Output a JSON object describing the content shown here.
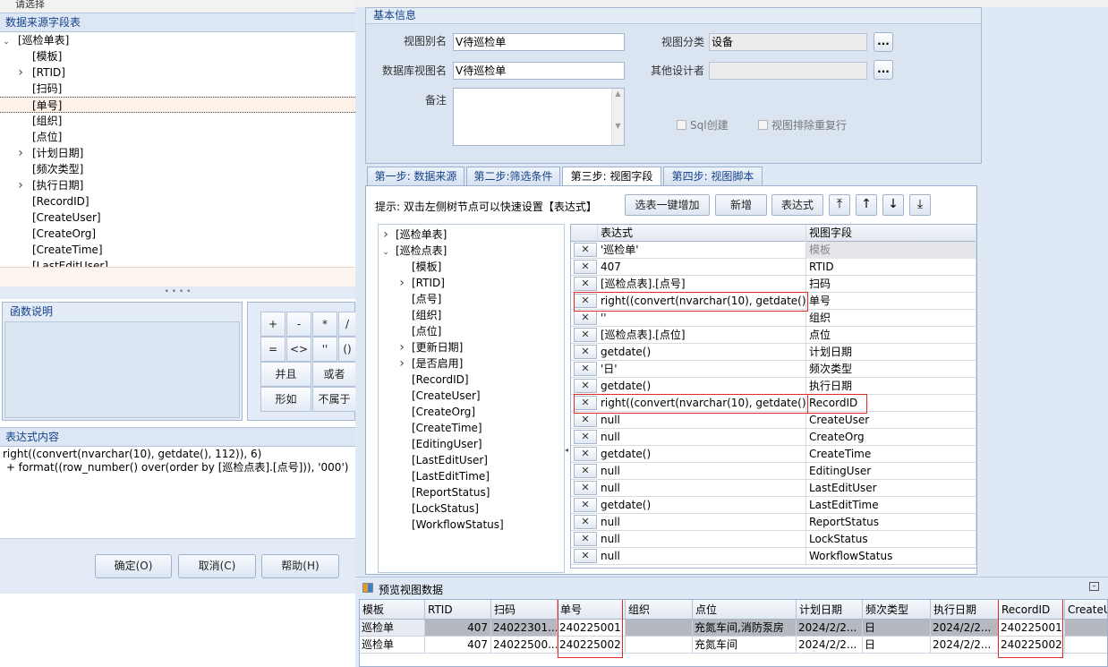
{
  "left_dialog": {
    "title": "请选择",
    "source_header": "数据来源字段表",
    "source_tree": [
      {
        "label": "[巡检单表]",
        "arrow": "open",
        "level": 0
      },
      {
        "label": "[模板]",
        "arrow": "",
        "level": 1
      },
      {
        "label": "[RTID]",
        "arrow": "closed",
        "level": 1
      },
      {
        "label": "[扫码]",
        "arrow": "",
        "level": 1
      },
      {
        "label": "[单号]",
        "arrow": "",
        "level": 1,
        "selected": true
      },
      {
        "label": "[组织]",
        "arrow": "",
        "level": 1
      },
      {
        "label": "[点位]",
        "arrow": "",
        "level": 1
      },
      {
        "label": "[计划日期]",
        "arrow": "closed",
        "level": 1
      },
      {
        "label": "[频次类型]",
        "arrow": "",
        "level": 1
      },
      {
        "label": "[执行日期]",
        "arrow": "closed",
        "level": 1
      },
      {
        "label": "[RecordID]",
        "arrow": "",
        "level": 1
      },
      {
        "label": "[CreateUser]",
        "arrow": "",
        "level": 1
      },
      {
        "label": "[CreateOrg]",
        "arrow": "",
        "level": 1
      },
      {
        "label": "[CreateTime]",
        "arrow": "",
        "level": 1
      },
      {
        "label": "[LastEditUser]",
        "arrow": "",
        "level": 1
      }
    ],
    "func_desc_title": "函数说明",
    "operators": [
      "+",
      "-",
      "*",
      "/",
      "=",
      "<>",
      "''",
      "()",
      "并且",
      "或者",
      "形如",
      "不属于"
    ],
    "expr_header": "表达式内容",
    "expr_text": "right((convert(nvarchar(10), getdate(), 112)), 6)\n + format((row_number() over(order by [巡检点表].[点号])), '000')",
    "buttons": {
      "ok": "确定(O)",
      "cancel": "取消(C)",
      "help": "帮助(H)"
    }
  },
  "basic_info": {
    "header": "基本信息",
    "view_alias_label": "视图别名",
    "view_alias_value": "V待巡检单",
    "db_view_label": "数据库视图名",
    "db_view_value": "V待巡检单",
    "remark_label": "备注",
    "category_label": "视图分类",
    "category_value": "设备",
    "other_designer_label": "其他设计者",
    "ellipsis": "...",
    "sql_create_label": "Sql创建",
    "dedupe_label": "视图排除重复行"
  },
  "tabs": [
    "第一步: 数据来源",
    "第二步:筛选条件",
    "第三步: 视图字段",
    "第四步: 视图脚本"
  ],
  "active_tab": 2,
  "hint": "提示: 双击左侧树节点可以快速设置【表达式】",
  "toolbar": {
    "select_add": "选表一键增加",
    "add_new": "新增",
    "expression": "表达式",
    "icons": [
      "move-top-icon",
      "move-up-icon",
      "move-down-icon",
      "move-bottom-icon"
    ],
    "glyphs": [
      "⤒",
      "↑",
      "↓",
      "⤓"
    ]
  },
  "field_tree": [
    {
      "label": "[巡检单表]",
      "arrow": "closed",
      "level": 0
    },
    {
      "label": "[巡检点表]",
      "arrow": "open",
      "level": 0
    },
    {
      "label": "[模板]",
      "arrow": "",
      "level": 1
    },
    {
      "label": "[RTID]",
      "arrow": "closed",
      "level": 1
    },
    {
      "label": "[点号]",
      "arrow": "",
      "level": 1
    },
    {
      "label": "[组织]",
      "arrow": "",
      "level": 1
    },
    {
      "label": "[点位]",
      "arrow": "",
      "level": 1
    },
    {
      "label": "[更新日期]",
      "arrow": "closed",
      "level": 1
    },
    {
      "label": "[是否启用]",
      "arrow": "closed",
      "level": 1
    },
    {
      "label": "[RecordID]",
      "arrow": "",
      "level": 1
    },
    {
      "label": "[CreateUser]",
      "arrow": "",
      "level": 1
    },
    {
      "label": "[CreateOrg]",
      "arrow": "",
      "level": 1
    },
    {
      "label": "[CreateTime]",
      "arrow": "",
      "level": 1
    },
    {
      "label": "[EditingUser]",
      "arrow": "",
      "level": 1
    },
    {
      "label": "[LastEditUser]",
      "arrow": "",
      "level": 1
    },
    {
      "label": "[LastEditTime]",
      "arrow": "",
      "level": 1
    },
    {
      "label": "[ReportStatus]",
      "arrow": "",
      "level": 1
    },
    {
      "label": "[LockStatus]",
      "arrow": "",
      "level": 1
    },
    {
      "label": "[WorkflowStatus]",
      "arrow": "",
      "level": 1
    }
  ],
  "field_grid": {
    "headers": [
      "表达式",
      "视图字段"
    ],
    "rows": [
      {
        "expr": "'巡检单'",
        "field": "模板",
        "grey": true
      },
      {
        "expr": "407",
        "field": "RTID"
      },
      {
        "expr": "[巡检点表].[点号]",
        "field": "扫码"
      },
      {
        "expr": "right((convert(nvarchar(10), getdate()...",
        "field": "单号",
        "boxed": true
      },
      {
        "expr": "''",
        "field": "组织"
      },
      {
        "expr": "[巡检点表].[点位]",
        "field": "点位"
      },
      {
        "expr": "getdate()",
        "field": "计划日期"
      },
      {
        "expr": "'日'",
        "field": "频次类型"
      },
      {
        "expr": "getdate()",
        "field": "执行日期"
      },
      {
        "expr": "right((convert(nvarchar(10), getdate()...",
        "field": "RecordID",
        "boxed": true
      },
      {
        "expr": "null",
        "field": "CreateUser"
      },
      {
        "expr": "null",
        "field": "CreateOrg"
      },
      {
        "expr": "getdate()",
        "field": "CreateTime"
      },
      {
        "expr": "null",
        "field": "EditingUser"
      },
      {
        "expr": "null",
        "field": "LastEditUser"
      },
      {
        "expr": "getdate()",
        "field": "LastEditTime"
      },
      {
        "expr": "null",
        "field": "ReportStatus"
      },
      {
        "expr": "null",
        "field": "LockStatus"
      },
      {
        "expr": "null",
        "field": "WorkflowStatus"
      }
    ],
    "delete_glyph": "✕"
  },
  "preview": {
    "title": "预览视图数据",
    "columns": [
      "模板",
      "RTID",
      "扫码",
      "单号",
      "组织",
      "点位",
      "计划日期",
      "频次类型",
      "执行日期",
      "RecordID",
      "CreateU"
    ],
    "rows": [
      [
        "巡检单",
        "407",
        "24022301...",
        "240225001",
        "",
        "充氮车间,消防泵房",
        "2024/2/2...",
        "日",
        "2024/2/2...",
        "240225001",
        ""
      ],
      [
        "巡检单",
        "407",
        "24022500...",
        "240225002",
        "",
        "充氮车间",
        "2024/2/2...",
        "日",
        "2024/2/2...",
        "240225002",
        ""
      ]
    ]
  }
}
